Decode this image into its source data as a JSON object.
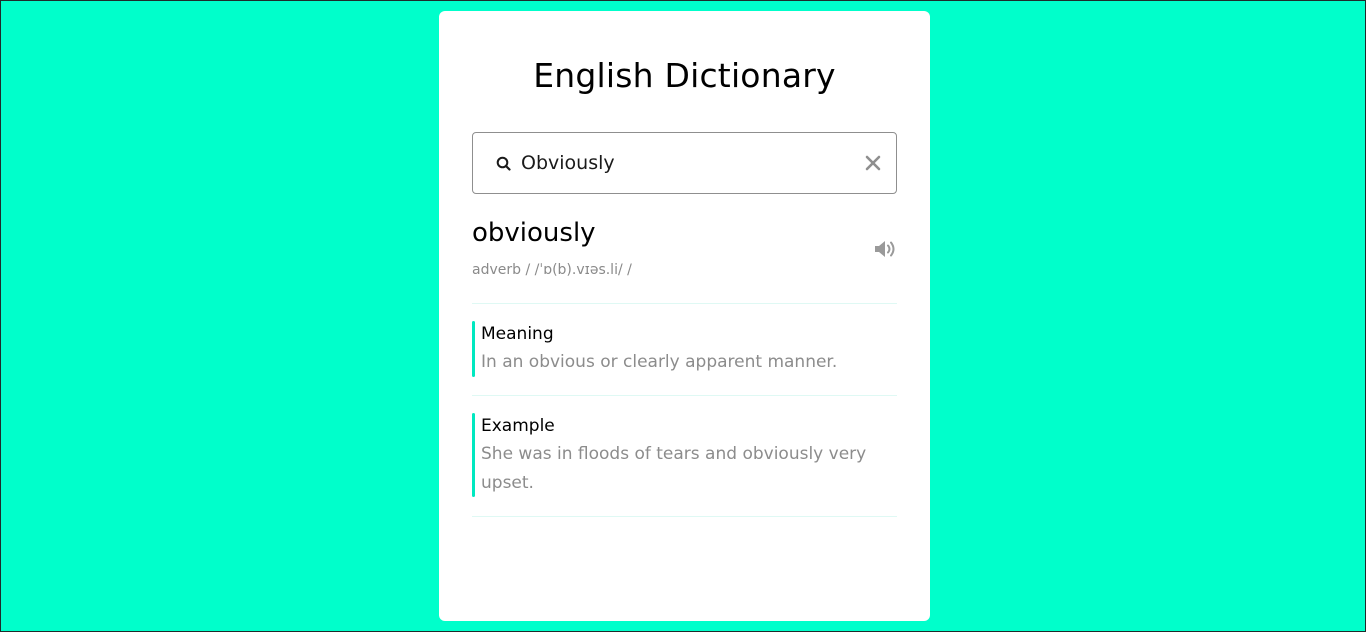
{
  "app": {
    "title": "English Dictionary"
  },
  "search": {
    "value": "Obviously",
    "placeholder": "Search"
  },
  "result": {
    "word": "obviously",
    "meta": "adverb /  /ˈɒ(b).vɪəs.li/  /"
  },
  "meaning": {
    "label": "Meaning",
    "text": "In an obvious or clearly apparent manner."
  },
  "example": {
    "label": "Example",
    "text": "She was in floods of tears and obviously very upset."
  },
  "icons": {
    "search": "search-icon",
    "clear": "close-icon",
    "audio": "speaker-icon"
  },
  "colors": {
    "background": "#00ffcb",
    "accent": "#00e8c0",
    "muted_text": "#8c8c8c"
  }
}
